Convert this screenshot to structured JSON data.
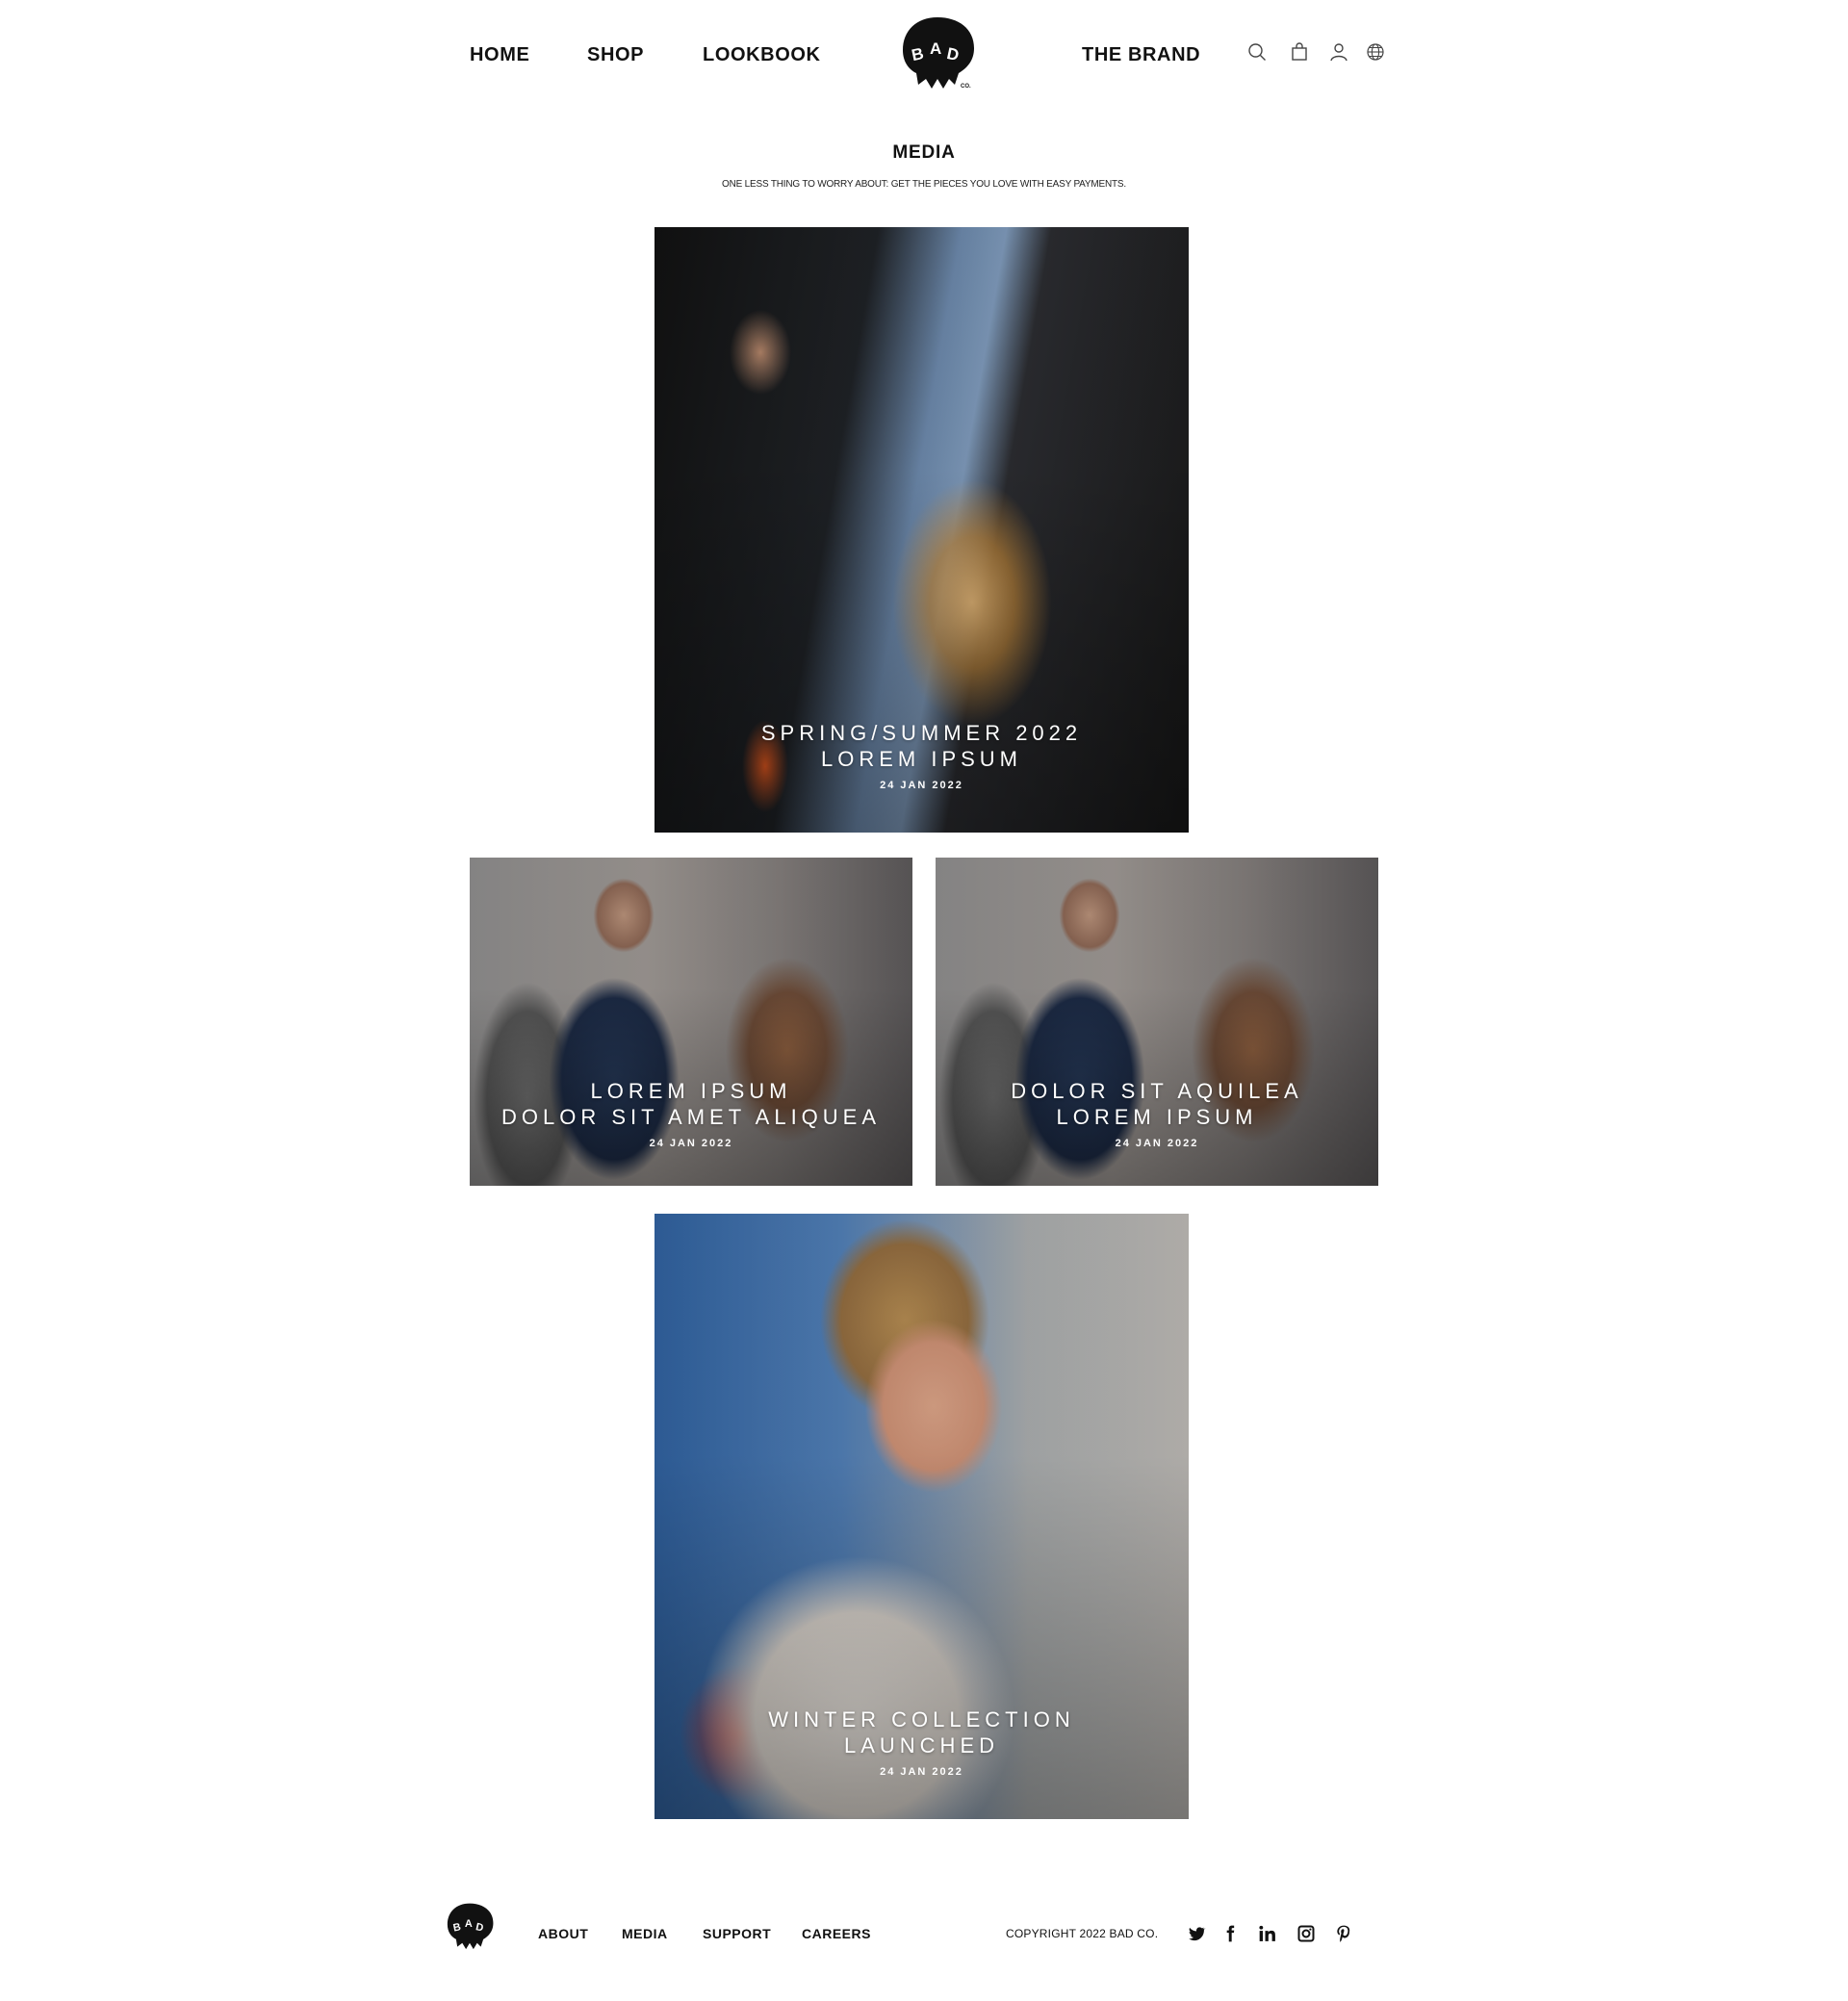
{
  "nav": {
    "home": "HOME",
    "shop": "SHOP",
    "lookbook": "LOOKBOOK",
    "brand": "THE BRAND"
  },
  "logo": {
    "text": "BAD",
    "suffix": "CO."
  },
  "header_icons": [
    "search-icon",
    "shopping-bag-icon",
    "user-icon",
    "globe-icon"
  ],
  "page": {
    "title": "MEDIA",
    "subtitle": "ONE LESS THING TO WORRY ABOUT: GET THE PIECES YOU LOVE WITH EASY PAYMENTS."
  },
  "cards": [
    {
      "line1": "SPRING/SUMMER 2022",
      "line2": "LOREM IPSUM",
      "date": "24 JAN 2022"
    },
    {
      "line1": "LOREM IPSUM",
      "line2": "DOLOR SIT AMET ALIQUEA",
      "date": "24 JAN 2022"
    },
    {
      "line1": "DOLOR SIT AQUILEA",
      "line2": "LOREM IPSUM",
      "date": "24 JAN 2022"
    },
    {
      "line1": "WINTER COLLECTION",
      "line2": "LAUNCHED",
      "date": "24 JAN 2022"
    }
  ],
  "footer": {
    "links": [
      "ABOUT",
      "MEDIA",
      "SUPPORT",
      "CAREERS"
    ],
    "copyright": "COPYRIGHT 2022 BAD CO.",
    "social_icons": [
      "twitter-icon",
      "facebook-icon",
      "linkedin-icon",
      "instagram-icon",
      "pinterest-icon"
    ]
  },
  "colors": {
    "text": "#111111",
    "background": "#ffffff",
    "caption": "#ffffff"
  }
}
